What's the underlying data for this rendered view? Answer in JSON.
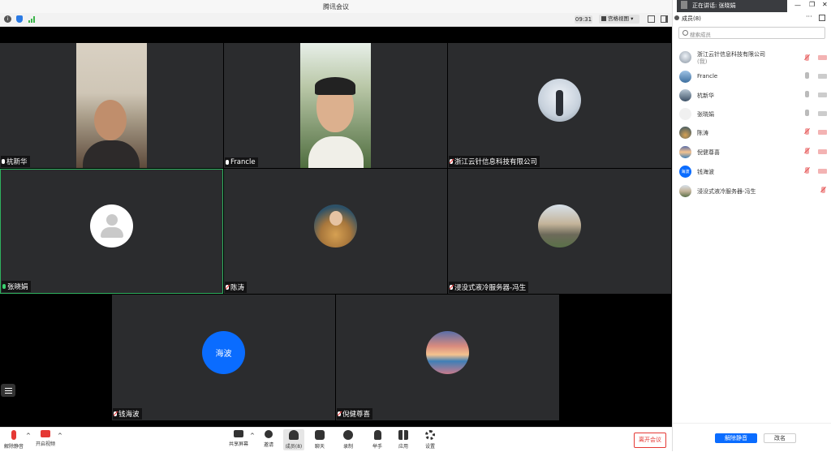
{
  "window": {
    "title": "腾讯会议",
    "time": "09:31",
    "view_mode": "宫格视图"
  },
  "speaking": {
    "label": "正在讲话: 张晓娟"
  },
  "participants_panel": {
    "title": "成员(8)",
    "search_placeholder": "搜索成员",
    "members": [
      {
        "name": "浙江云针信息科技有限公司",
        "sub": "(我)",
        "mic": "muted",
        "cam": "off"
      },
      {
        "name": "Francle",
        "sub": "",
        "mic": "on",
        "cam": "on"
      },
      {
        "name": "杭新华",
        "sub": "",
        "mic": "on",
        "cam": "on"
      },
      {
        "name": "张晓娟",
        "sub": "",
        "mic": "on",
        "cam": "on"
      },
      {
        "name": "陈涛",
        "sub": "",
        "mic": "muted",
        "cam": "off"
      },
      {
        "name": "倪健尊喜",
        "sub": "",
        "mic": "muted",
        "cam": "off"
      },
      {
        "name": "钱海波",
        "sub": "",
        "mic": "muted",
        "cam": "off"
      },
      {
        "name": "浸没式液冷服务器-冯生",
        "sub": "",
        "mic": "muted",
        "cam": "none"
      }
    ],
    "avatar_text_haibo": "海波",
    "unmute_all_label": "解除静音",
    "rename_label": "改名"
  },
  "tiles": [
    {
      "name": "杭新华",
      "mic": "on"
    },
    {
      "name": "Francle",
      "mic": "on"
    },
    {
      "name": "浙江云针信息科技有限公司",
      "mic": "muted"
    },
    {
      "name": "张晓娟",
      "mic": "on"
    },
    {
      "name": "陈涛",
      "mic": "muted"
    },
    {
      "name": "浸没式液冷服务器-冯生",
      "mic": "muted"
    },
    {
      "name": "钱海波",
      "mic": "muted"
    },
    {
      "name": "倪健尊喜",
      "mic": "muted"
    }
  ],
  "toolbar": {
    "unmute": "解除静音",
    "start_video": "开启视频",
    "share_screen": "共享屏幕",
    "invite": "邀请",
    "members": "成员(8)",
    "chat": "聊天",
    "record": "录制",
    "raise_hand": "举手",
    "apps": "应用",
    "settings": "设置",
    "leave": "离开会议"
  },
  "colors": {
    "accent": "#0a6cff",
    "danger": "#e53935",
    "tile_bg": "#2b2c2e",
    "active_border": "#2fb15f"
  }
}
